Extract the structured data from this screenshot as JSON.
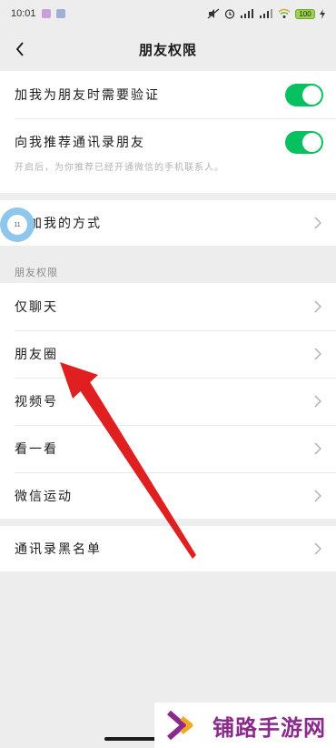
{
  "status_bar": {
    "time": "10:01",
    "battery": "100"
  },
  "header": {
    "title": "朋友权限"
  },
  "settings": {
    "verify_label": "加我为朋友时需要验证",
    "verify_on": true,
    "recommend_label": "向我推荐通讯录朋友",
    "recommend_on": true,
    "recommend_hint": "开启后，为你推荐已经开通微信的手机联系人。",
    "add_method_label": "添加我的方式"
  },
  "permissions": {
    "section_title": "朋友权限",
    "items": [
      {
        "label": "仅聊天"
      },
      {
        "label": "朋友圈"
      },
      {
        "label": "视频号"
      },
      {
        "label": "看一看"
      },
      {
        "label": "微信运动"
      }
    ]
  },
  "blacklist": {
    "label": "通讯录黑名单"
  },
  "overlay": {
    "arrow_color": "#e02020",
    "float_ball_text": "11"
  },
  "watermark": {
    "text": "铺路手游网",
    "brand_color": "#8b2a8c",
    "accent_color": "#f5a623"
  },
  "colors": {
    "toggle_on": "#07c160",
    "background": "#ededed"
  }
}
